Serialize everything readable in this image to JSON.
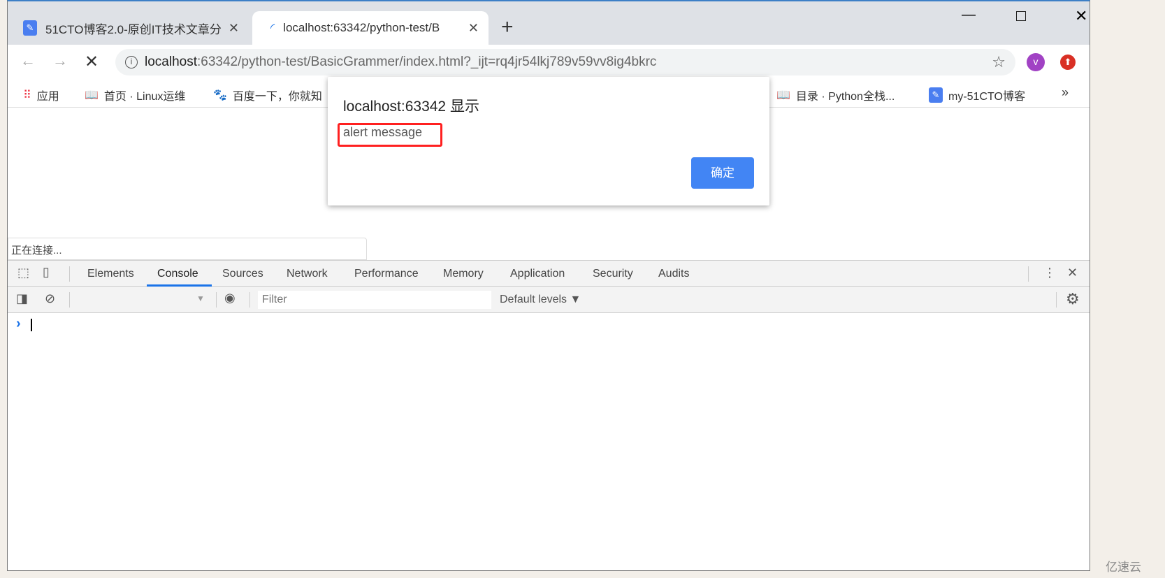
{
  "browser": {
    "tabs": [
      {
        "title": "51CTO博客2.0-原创IT技术文章分",
        "active": false
      },
      {
        "title": "localhost:63342/python-test/B",
        "active": true
      }
    ],
    "url_host": "localhost",
    "url_rest": ":63342/python-test/BasicGrammer/index.html?_ijt=rq4jr54lkj789v59vv8ig4bkrc",
    "profile_initial": "v",
    "bookmarks": [
      "应用",
      "首页 · Linux运维",
      "百度一下，你就知",
      "目录 · Python全栈...",
      "my-51CTO博客"
    ],
    "bookmarks_more": "»",
    "status_text": "正在连接..."
  },
  "dialog": {
    "title": "localhost:63342 显示",
    "message": "alert message",
    "ok_label": "确定",
    "accent": "#4285f4",
    "highlight": "#ff2020"
  },
  "devtools": {
    "tabs": [
      "Elements",
      "Console",
      "Sources",
      "Network",
      "Performance",
      "Memory",
      "Application",
      "Security",
      "Audits"
    ],
    "active_tab": "Console",
    "filter_placeholder": "Filter",
    "levels_label": "Default levels ▼",
    "prompt": "›"
  },
  "watermark": "亿速云"
}
